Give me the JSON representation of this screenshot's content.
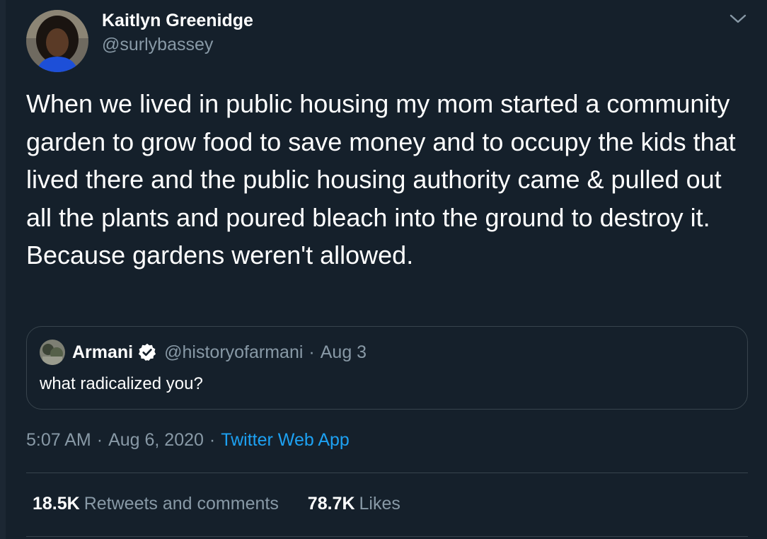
{
  "author": {
    "name": "Kaitlyn Greenidge",
    "handle": "@surlybassey"
  },
  "tweet_text": "When we lived in public housing my mom started a community garden to grow food to save money and to occupy the kids that lived there and the public housing authority came & pulled out all the plants and poured bleach into the ground to destroy it. Because gardens weren't allowed.",
  "quoted_tweet": {
    "name": "Armani",
    "handle": "@historyofarmani",
    "separator": "·",
    "date": "Aug 3",
    "text": "what radicalized you?"
  },
  "meta": {
    "time": "5:07 AM",
    "separator": "·",
    "date": "Aug 6, 2020",
    "source": "Twitter Web App"
  },
  "stats": {
    "retweets_count": "18.5K",
    "retweets_label": "Retweets and comments",
    "likes_count": "78.7K",
    "likes_label": "Likes"
  },
  "colors": {
    "background": "#15202b",
    "text_primary": "#ffffff",
    "text_secondary": "#8899a6",
    "link": "#1da1f2",
    "border": "#38444d",
    "verified_badge": "#ffffff"
  },
  "icons": {
    "menu": "chevron-down-icon",
    "verified": "verified-badge-icon"
  }
}
